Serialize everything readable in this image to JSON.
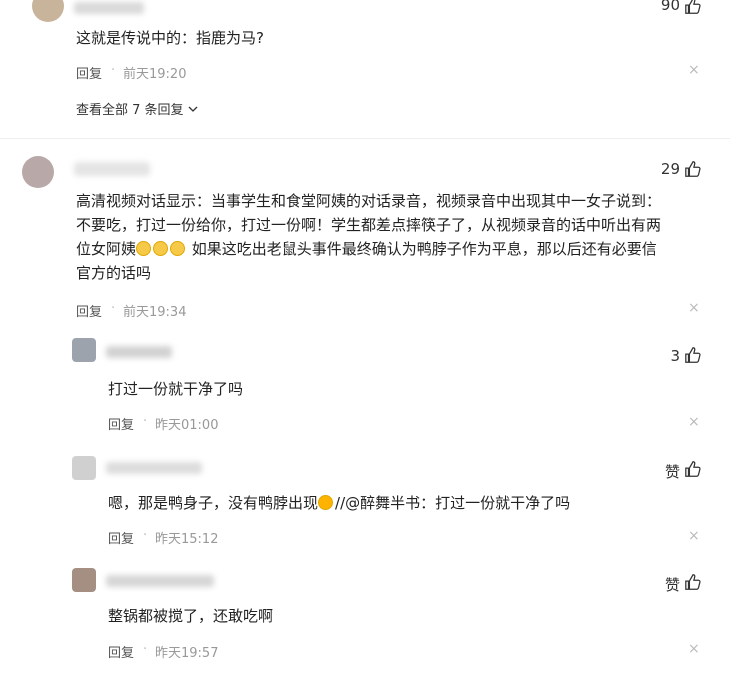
{
  "top": {
    "likes": "90",
    "text": "这就是传说中的：指鹿为马?",
    "reply_label": "回复",
    "time": "前天19:20",
    "view_all": "查看全部 7 条回复"
  },
  "main": {
    "likes": "29",
    "line1": "高清视频对话显示：当事学生和食堂阿姨的对话录音，视频录音中出现其中一女子说到：",
    "line2": "不要吃，打过一份给你，打过一份啊！学生都差点摔筷子了，从视频录音的话中听出有两",
    "line3a": "位女阿姨",
    "line3b": "如果这吃出老鼠头事件最终确认为鸭脖子作为平息，那以后还有必要信",
    "line4": "官方的话吗",
    "reply_label": "回复",
    "time": "前天19:34"
  },
  "replies": [
    {
      "likes": "3",
      "text": "打过一份就干净了吗",
      "reply_label": "回复",
      "time": "昨天01:00"
    },
    {
      "likes": "赞",
      "text_a": "嗯，那是鸭身子，没有鸭脖出现",
      "text_b": "//@醉舞半书：打过一份就干净了吗",
      "reply_label": "回复",
      "time": "昨天15:12"
    },
    {
      "likes": "赞",
      "text": "整锅都被搅了，还敢吃啊",
      "reply_label": "回复",
      "time": "昨天19:57"
    }
  ],
  "icons": {
    "dot": "·",
    "close": "×"
  }
}
